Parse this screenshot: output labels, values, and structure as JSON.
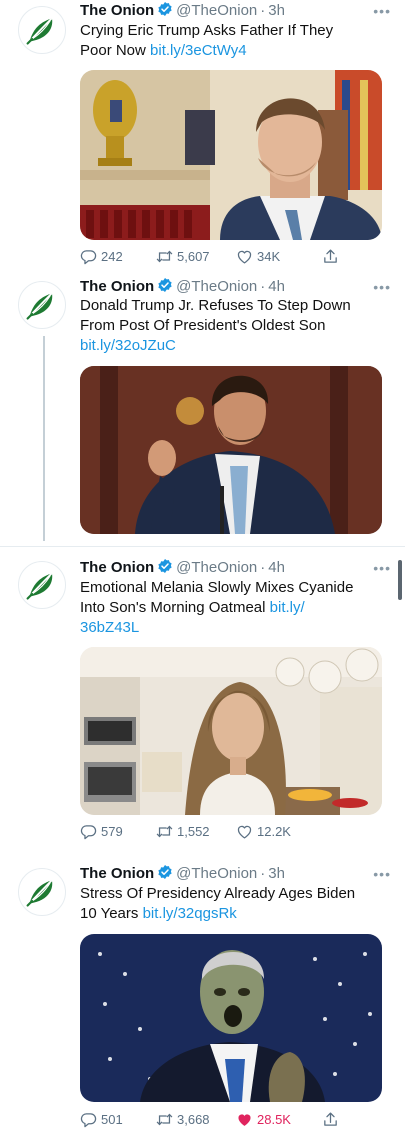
{
  "brand": {
    "color": "#1b95e0",
    "onion_green": "#1e7a32",
    "like_red": "#e0245e"
  },
  "tweets": [
    {
      "name": "The Onion",
      "handle": "@TheOnion",
      "sep": "·",
      "time": "3h",
      "text": "Crying Eric Trump Asks Father If They Poor Now",
      "text_line1": "Crying Eric Trump Asks Father If They",
      "text_line2": "Poor Now",
      "link": "bit.ly/3eCtWy4",
      "replies": "242",
      "retweets": "5,607",
      "likes": "34K",
      "liked": false
    },
    {
      "name": "The Onion",
      "handle": "@TheOnion",
      "sep": "·",
      "time": "4h",
      "text_line1": "Donald Trump Jr. Refuses To Step Down",
      "text_line2": "From Post Of President's Oldest Son",
      "link": "bit.ly/32oJZuC"
    },
    {
      "name": "The Onion",
      "handle": "@TheOnion",
      "sep": "·",
      "time": "4h",
      "text_line1": "Emotional Melania Slowly Mixes Cyanide",
      "text_line2": "Into Son's Morning Oatmeal",
      "link_part1": "bit.ly/",
      "link_part2": "36bZ43L",
      "replies": "579",
      "retweets": "1,552",
      "likes": "12.2K",
      "liked": false
    },
    {
      "name": "The Onion",
      "handle": "@TheOnion",
      "sep": "·",
      "time": "3h",
      "text_line1": "Stress Of Presidency Already Ages Biden",
      "text_line2": "10 Years",
      "link": "bit.ly/32qgsRk",
      "replies": "501",
      "retweets": "3,668",
      "likes": "28.5K",
      "liked": true
    }
  ],
  "icons": {
    "avatar": "onion-logo-icon",
    "verified": "verified-badge-icon",
    "more": "more-options-icon",
    "reply": "reply-icon",
    "retweet": "retweet-icon",
    "like": "heart-icon",
    "share": "share-icon"
  },
  "more_glyph": "•••"
}
